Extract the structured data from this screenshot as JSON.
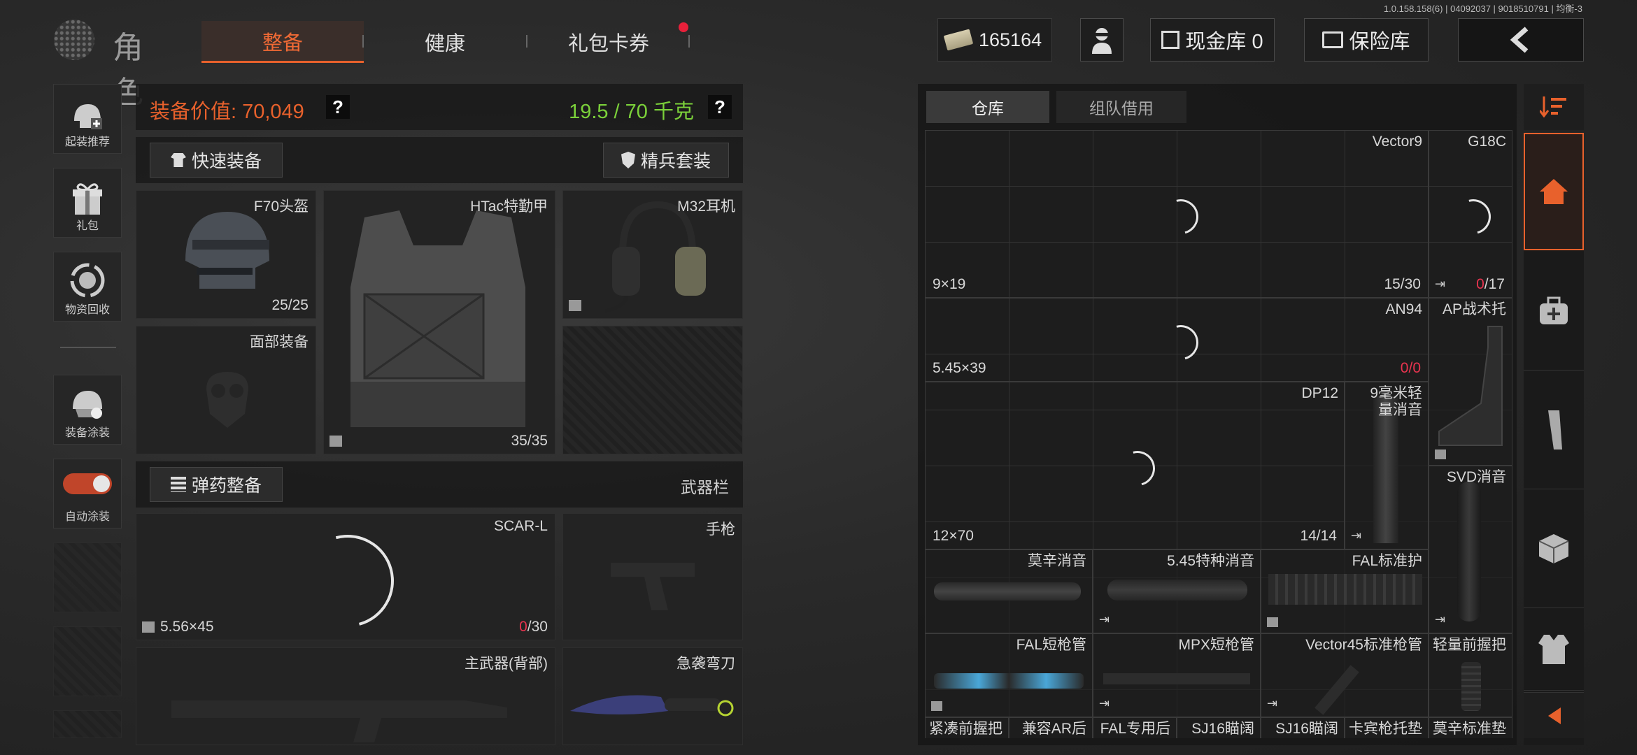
{
  "version_info": "1.0.158.158(6) | 04092037 | 9018510791 | 均衡-3",
  "header": {
    "logo_text": "角色",
    "tabs": [
      {
        "label": "整备",
        "active": true
      },
      {
        "label": "健康",
        "active": false
      },
      {
        "label": "礼包卡券",
        "active": false,
        "badge": true
      }
    ],
    "currency_value": "165164",
    "cash_vault_label": "现金库 0",
    "insurance_label": "保险库"
  },
  "left_sidebar": [
    {
      "label": "起装推荐",
      "icon": "helmet-recommend-icon"
    },
    {
      "label": "礼包",
      "icon": "gift-icon"
    },
    {
      "label": "物资回收",
      "icon": "recycle-icon"
    },
    {
      "label": "装备涂装",
      "icon": "paint-helmet-icon"
    },
    {
      "label": "自动涂装",
      "icon": "toggle-icon",
      "toggle_on": true
    }
  ],
  "loadout": {
    "value_label": "装备价值: 70,049",
    "weight_label": "19.5 / 70 千克",
    "quick_equip_label": "快速装备",
    "elite_set_label": "精兵套装",
    "helmet": {
      "name": "F70头盔",
      "durability": "25/25"
    },
    "armor": {
      "name": "HTac特勤甲",
      "durability": "35/35"
    },
    "headset": {
      "name": "M32耳机"
    },
    "face": {
      "name": "面部装备"
    },
    "ammo_btn_label": "弹药整备",
    "weapon_bar_label": "武器栏",
    "primary": {
      "name": "SCAR-L",
      "caliber": "5.56×45",
      "ammo_cur": "0",
      "ammo_max": "/30"
    },
    "pistol": {
      "name": "手枪"
    },
    "back_weapon": {
      "name": "主武器(背部)"
    },
    "melee": {
      "name": "急袭弯刀"
    }
  },
  "storage": {
    "tabs": [
      {
        "label": "仓库",
        "active": true
      },
      {
        "label": "组队借用",
        "active": false
      }
    ],
    "items": {
      "vector9": {
        "name": "Vector9",
        "caliber": "9×19",
        "ammo": "15/30"
      },
      "g18c": {
        "name": "G18C",
        "ammo_cur": "0",
        "ammo_max": "/17"
      },
      "an94": {
        "name": "AN94",
        "caliber": "5.45×39",
        "ammo_cur": "0",
        "ammo_max": "/0"
      },
      "ap_stock": {
        "name": "AP战术托"
      },
      "dp12": {
        "name": "DP12",
        "caliber": "12×70",
        "ammo": "14/14"
      },
      "supp9": {
        "name": "9毫米轻量消音"
      },
      "svd_supp": {
        "name": "SVD消音"
      },
      "mosin_supp": {
        "name": "莫辛消音"
      },
      "supp545": {
        "name": "5.45特种消音"
      },
      "fal_guard": {
        "name": "FAL标准护"
      },
      "fal_short": {
        "name": "FAL短枪管"
      },
      "mpx_short": {
        "name": "MPX短枪管"
      },
      "vector45": {
        "name": "Vector45标准枪管"
      },
      "light_grip": {
        "name": "轻量前握把"
      },
      "row_bottom": [
        "紧凑前握把",
        "兼容AR后",
        "FAL专用后",
        "SJ16瞄阔",
        "SJ16瞄阔",
        "卡宾枪托垫",
        "莫辛标准垫"
      ]
    }
  },
  "right_bar": [
    "home-icon",
    "medkit-icon",
    "magazine-icon",
    "crate-icon",
    "vest-icon"
  ],
  "colors": {
    "accent": "#e8612c",
    "weight_green": "#7bd13a",
    "ammo_red": "#e8344f"
  }
}
